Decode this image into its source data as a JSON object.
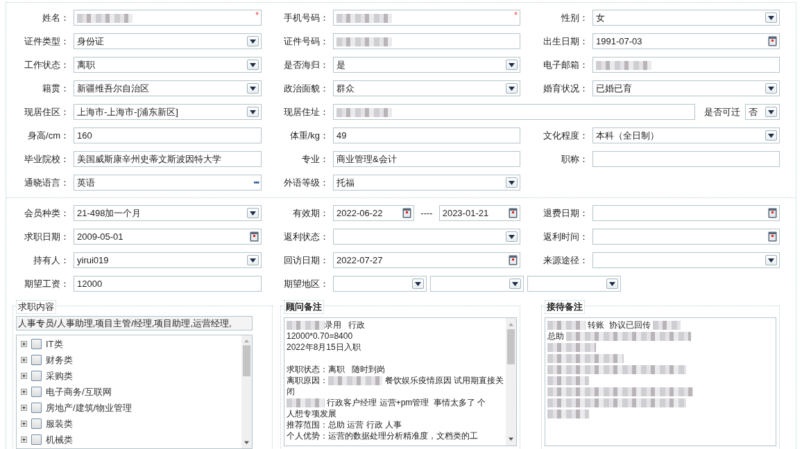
{
  "profile": {
    "rows": [
      {
        "cells": [
          {
            "label": "姓名：",
            "kind": "text",
            "blurred": true,
            "required_mark": "*"
          },
          {
            "label": "手机号码：",
            "kind": "text",
            "blurred": true,
            "required_mark": "*"
          },
          {
            "label": "性别：",
            "kind": "select",
            "value": "女"
          }
        ]
      },
      {
        "cells": [
          {
            "label": "证件类型：",
            "kind": "select",
            "value": "身份证"
          },
          {
            "label": "证件号码：",
            "kind": "text",
            "blurred": true
          },
          {
            "label": "出生日期：",
            "kind": "date",
            "value": "1991-07-03"
          }
        ]
      },
      {
        "cells": [
          {
            "label": "工作状态：",
            "kind": "select",
            "value": "离职"
          },
          {
            "label": "是否海归：",
            "kind": "select",
            "value": "是"
          },
          {
            "label": "电子邮箱：",
            "kind": "text",
            "blurred": true
          }
        ]
      },
      {
        "cells": [
          {
            "label": "籍贯：",
            "kind": "select",
            "value": "新疆维吾尔自治区"
          },
          {
            "label": "政治面貌：",
            "kind": "select",
            "value": "群众"
          },
          {
            "label": "婚育状况：",
            "kind": "select",
            "value": "已婚已育"
          }
        ]
      },
      {
        "cells": [
          {
            "label": "现居住区：",
            "kind": "select",
            "value": " 上海市-上海市-[浦东新区]"
          },
          {
            "label": "现居住址：",
            "kind": "group",
            "parts": [
              {
                "kind": "text",
                "blurred": true
              },
              {
                "kind": "label",
                "text": "是否可迁"
              },
              {
                "kind": "select",
                "value": "否"
              }
            ]
          }
        ]
      },
      {
        "cells": [
          {
            "label": "身高/cm：",
            "kind": "text",
            "value": "160"
          },
          {
            "label": "体重/kg：",
            "kind": "text",
            "value": "49"
          },
          {
            "label": "文化程度：",
            "kind": "select",
            "value": "本科（全日制）"
          }
        ]
      },
      {
        "cells": [
          {
            "label": "毕业院校：",
            "kind": "text",
            "value": "美国威斯康辛州史蒂文斯波因特大学"
          },
          {
            "label": "专业：",
            "kind": "text",
            "value": "商业管理&会计"
          },
          {
            "label": "职称：",
            "kind": "text"
          }
        ]
      },
      {
        "cells": [
          {
            "label": "通晓语言：",
            "kind": "picker",
            "value": "英语",
            "button": "•••"
          },
          {
            "label": "外语等级：",
            "kind": "select",
            "value": "托福"
          }
        ]
      }
    ]
  },
  "membership": {
    "rows": [
      {
        "cells": [
          {
            "label": "会员种类：",
            "kind": "select",
            "value": " 21-498加一个月"
          },
          {
            "label": "有效期：",
            "kind": "group",
            "parts": [
              {
                "kind": "date",
                "value": "2022-06-22"
              },
              {
                "kind": "label",
                "text": "----"
              },
              {
                "kind": "date",
                "value": "2023-01-21"
              }
            ]
          },
          {
            "label": "退费日期：",
            "kind": "date"
          }
        ]
      },
      {
        "cells": [
          {
            "label": "求职日期：",
            "kind": "date",
            "value": "2009-05-01"
          },
          {
            "label": "返利状态：",
            "kind": "select"
          },
          {
            "label": "返利时间：",
            "kind": "date"
          }
        ]
      },
      {
        "cells": [
          {
            "label": "持有人：",
            "kind": "select",
            "value": "yirui019"
          },
          {
            "label": "回访日期：",
            "kind": "date",
            "value": "2022-07-27"
          },
          {
            "label": "来源途径：",
            "kind": "select"
          }
        ]
      },
      {
        "cells": [
          {
            "label": "期望工资：",
            "kind": "text",
            "value": "12000"
          },
          {
            "label": "期望地区：",
            "kind": "group",
            "parts": [
              {
                "kind": "select"
              },
              {
                "kind": "select"
              },
              {
                "kind": "select"
              }
            ]
          }
        ]
      }
    ]
  },
  "job_panel": {
    "title": "求职内容",
    "bold": false,
    "summary": "人事专员/人事助理,项目主管/经理,项目助理,运营经理,",
    "tree": [
      {
        "label": "IT类",
        "expanded": false,
        "checked": false
      },
      {
        "label": "财务类",
        "expanded": false,
        "checked": false
      },
      {
        "label": "采购类",
        "expanded": false,
        "checked": false
      },
      {
        "label": "电子商务/互联网",
        "expanded": false,
        "checked": false
      },
      {
        "label": "房地产/建筑/物业管理",
        "expanded": false,
        "checked": false
      },
      {
        "label": "服装类",
        "expanded": false,
        "checked": false
      },
      {
        "label": "机械类",
        "expanded": false,
        "checked": false
      }
    ]
  },
  "notes": [
    {
      "title": "顾问备注",
      "bold": true,
      "scrollbar": true,
      "lines": [
        {
          "parts": [
            {
              "blurred": true
            },
            {
              "text": "录用   行政"
            }
          ]
        },
        {
          "parts": [
            {
              "text": "12000*0.70=8400"
            }
          ]
        },
        {
          "parts": [
            {
              "text": "2022年8月15日入职"
            }
          ]
        },
        {
          "spaced": true,
          "parts": [
            {
              "text": "求职状态：离职   随时到岗"
            }
          ]
        },
        {
          "parts": [
            {
              "text": "离职原因："
            },
            {
              "blurred": true
            },
            {
              "text": " 餐饮娱乐疫情原因 试用期直接关"
            }
          ]
        },
        {
          "parts": [
            {
              "text": "闭"
            }
          ]
        },
        {
          "parts": [
            {
              "blurred": true
            },
            {
              "text": " 行政客户经理 运营+pm管理  事情太多了 个"
            }
          ]
        },
        {
          "parts": [
            {
              "text": "人想专项发展"
            }
          ]
        },
        {
          "parts": [
            {
              "text": "推荐范围：总助 运营 行政 人事"
            }
          ]
        },
        {
          "parts": [
            {
              "text": "个人优势：运营的数据处理分析精准度，文档类的工"
            }
          ]
        }
      ]
    },
    {
      "title": "接待备注",
      "bold": true,
      "scrollbar": false,
      "lines": [
        {
          "parts": [
            {
              "blurred": true
            },
            {
              "text": " 转账  协议已回传 "
            },
            {
              "blurred": true
            }
          ]
        },
        {
          "parts": [
            {
              "text": "总助 "
            },
            {
              "blurred": true
            }
          ]
        },
        {
          "parts": [
            {
              "blurred": true
            }
          ]
        },
        {
          "parts": [
            {
              "blurred": true
            }
          ]
        },
        {
          "parts": [
            {
              "blurred": true
            }
          ]
        },
        {
          "parts": [
            {
              "blurred": true
            }
          ]
        },
        {
          "parts": [
            {
              "blurred": true
            }
          ]
        },
        {
          "parts": [
            {
              "blurred": true
            }
          ]
        },
        {
          "parts": [
            {
              "blurred": true
            }
          ]
        }
      ]
    }
  ]
}
